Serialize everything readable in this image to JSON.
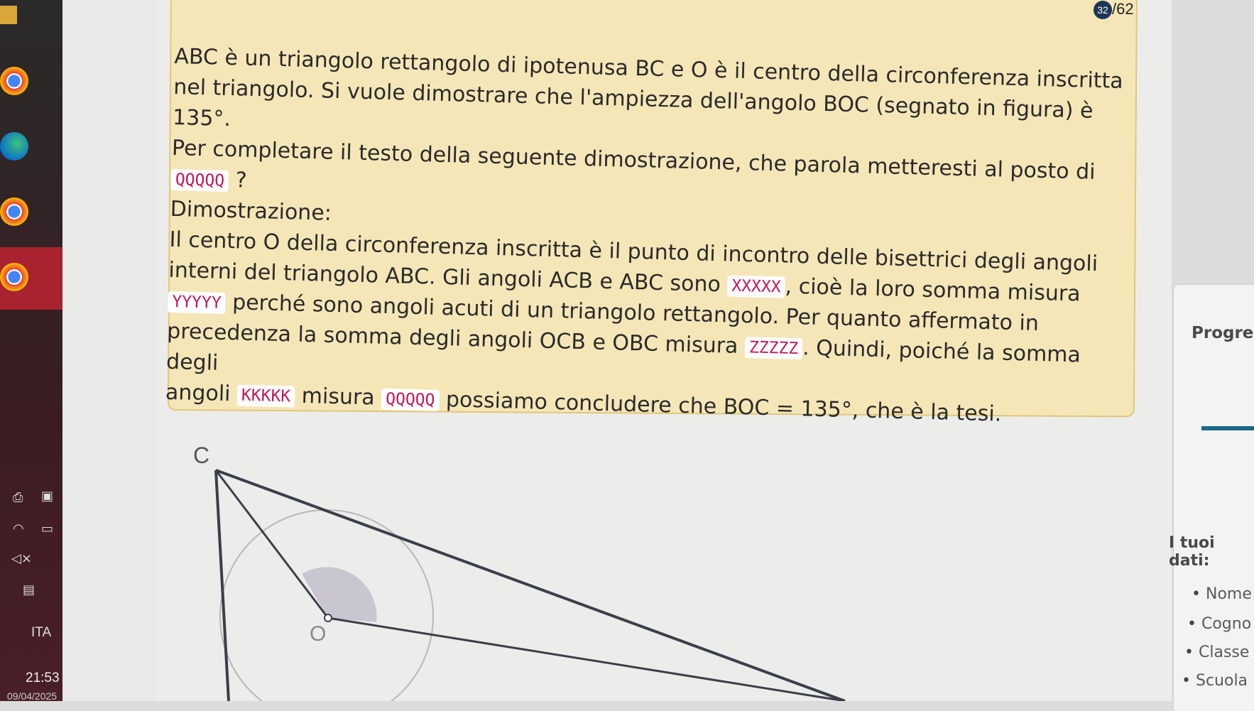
{
  "taskbar": {
    "time": "21:53",
    "date": "09/04/2025",
    "language": "ITA"
  },
  "question": {
    "counter_badge": "32",
    "counter_total": "/62",
    "intro_lines": [
      "ABC è un triangolo rettangolo di ipotenusa BC e O è il centro della circonferenza inscritta",
      "nel triangolo. Si vuole dimostrare che l'ampiezza dell'angolo BOC (segnato in figura) è 135°.",
      "Per completare il testo della seguente dimostrazione, che parola metteresti al posto di"
    ],
    "ask_blank": "QQQQQ",
    "ask_suffix": "?",
    "proof_heading": "Dimostrazione:",
    "proof": {
      "l1": "Il centro O della circonferenza inscritta è il punto di incontro delle bisettrici degli angoli",
      "l2a": "interni del triangolo ABC. Gli angoli ACB e ABC sono",
      "blank_x": "XXXXX",
      "l2b": ", cioè la loro somma misura",
      "blank_y": "YYYYY",
      "l3": "perché sono angoli acuti di un triangolo rettangolo. Per quanto affermato in",
      "l4a": "precedenza la somma degli angoli OCB e OBC misura",
      "blank_z": "ZZZZZ",
      "l4b": ". Quindi, poiché la somma degli",
      "l5a": "angoli",
      "blank_k": "KKKKK",
      "l5b": "misura",
      "blank_q": "QQQQQ",
      "l5c": "possiamo concludere che BOC = 135°, che è la tesi."
    }
  },
  "figure": {
    "label_c": "C",
    "label_o": "O"
  },
  "side_panel": {
    "progress_label": "Progres",
    "data_label": "I tuoi dati:",
    "items": [
      "Nome",
      "Cogno",
      "Classe",
      "Scuola"
    ]
  }
}
